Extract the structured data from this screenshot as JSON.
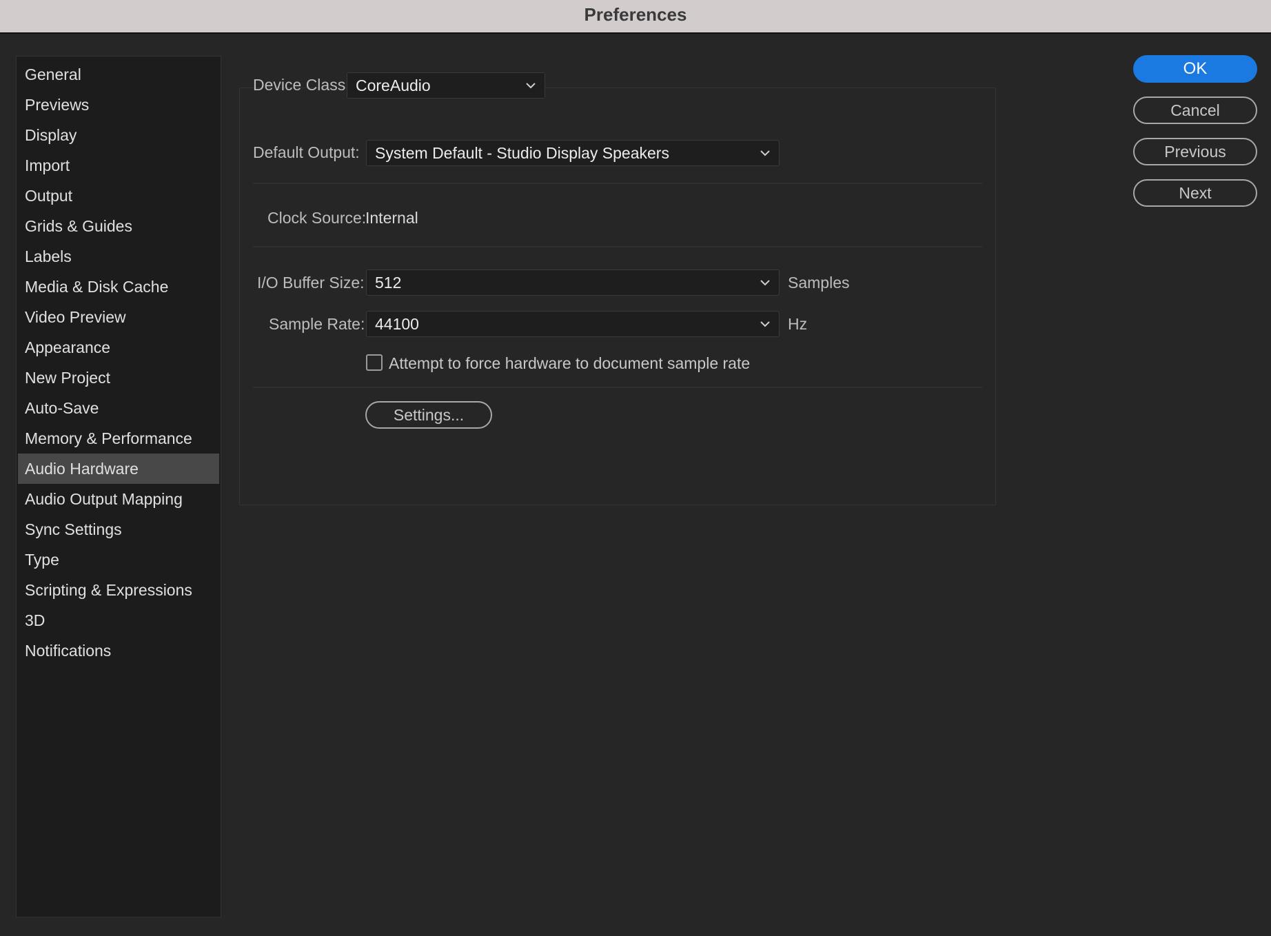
{
  "window": {
    "title": "Preferences"
  },
  "sidebar": {
    "items": [
      {
        "label": "General"
      },
      {
        "label": "Previews"
      },
      {
        "label": "Display"
      },
      {
        "label": "Import"
      },
      {
        "label": "Output"
      },
      {
        "label": "Grids & Guides"
      },
      {
        "label": "Labels"
      },
      {
        "label": "Media & Disk Cache"
      },
      {
        "label": "Video Preview"
      },
      {
        "label": "Appearance"
      },
      {
        "label": "New Project"
      },
      {
        "label": "Auto-Save"
      },
      {
        "label": "Memory & Performance"
      },
      {
        "label": "Audio Hardware",
        "selected": true
      },
      {
        "label": "Audio Output Mapping"
      },
      {
        "label": "Sync Settings"
      },
      {
        "label": "Type"
      },
      {
        "label": "Scripting & Expressions"
      },
      {
        "label": "3D"
      },
      {
        "label": "Notifications"
      }
    ]
  },
  "audio_hardware": {
    "device_class": {
      "label": "Device Class:",
      "value": "CoreAudio"
    },
    "default_output": {
      "label": "Default Output:",
      "value": "System Default - Studio Display Speakers"
    },
    "clock_source": {
      "label": "Clock Source:",
      "value": "Internal"
    },
    "buffer_size": {
      "label": "I/O Buffer Size:",
      "value": "512",
      "unit": "Samples"
    },
    "sample_rate": {
      "label": "Sample Rate:",
      "value": "44100",
      "unit": "Hz"
    },
    "force_rate": {
      "label": "Attempt to force hardware to document sample rate",
      "checked": false
    },
    "settings_button": "Settings..."
  },
  "buttons": {
    "ok": "OK",
    "cancel": "Cancel",
    "previous": "Previous",
    "next": "Next"
  },
  "colors": {
    "accent": "#1b7ae2",
    "selected_item": "#484848",
    "background": "#262626"
  }
}
